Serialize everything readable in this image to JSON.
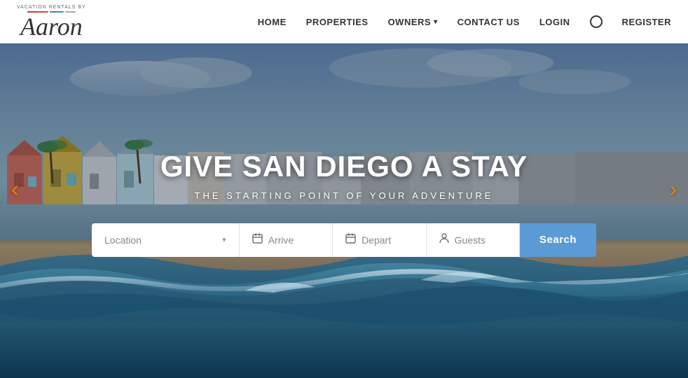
{
  "header": {
    "logo": {
      "script_text": "Aaron",
      "tagline": "VACATION RENTALS BY"
    },
    "nav": {
      "items": [
        {
          "label": "HOME",
          "id": "home"
        },
        {
          "label": "PROPERTIES",
          "id": "properties"
        },
        {
          "label": "OWNERS",
          "id": "owners",
          "has_dropdown": true
        },
        {
          "label": "CONTACT US",
          "id": "contact"
        },
        {
          "label": "LOGIN",
          "id": "login"
        },
        {
          "label": "REGISTER",
          "id": "register"
        }
      ]
    }
  },
  "hero": {
    "title": "GIVE SAN DIEGO A STAY",
    "subtitle": "THE STARTING POINT OF YOUR ADVENTURE",
    "arrow_left": "‹",
    "arrow_right": "›",
    "search": {
      "location_placeholder": "Location",
      "arrive_placeholder": "Arrive",
      "depart_placeholder": "Depart",
      "guests_placeholder": "Guests",
      "search_button_label": "Search"
    }
  }
}
